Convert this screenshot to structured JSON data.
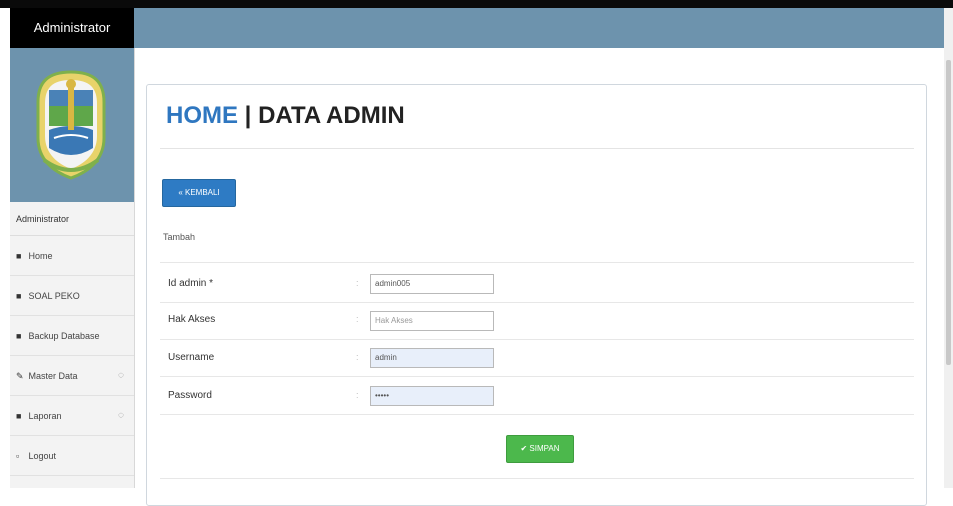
{
  "brand": {
    "title": "Administrator"
  },
  "sidebar": {
    "role": "Administrator",
    "items": [
      {
        "icon": "home-icon",
        "glyph": "■",
        "label": "Home"
      },
      {
        "icon": "home-icon",
        "glyph": "■",
        "label": "SOAL PEKO"
      },
      {
        "icon": "home-icon",
        "glyph": "■",
        "label": "Backup Database"
      },
      {
        "icon": "edit-icon",
        "glyph": "✎",
        "label": "Master Data",
        "caret": "◌"
      },
      {
        "icon": "report-icon",
        "glyph": "■",
        "label": "Laporan",
        "caret": "◌"
      },
      {
        "icon": "logout-icon",
        "glyph": "▫",
        "label": "Logout"
      }
    ]
  },
  "page": {
    "title_home": "HOME",
    "title_sep": " | ",
    "title_main": "DATA ADMIN",
    "back_button": "« KEMBALI",
    "section_label": "Tambah",
    "save_button": "✔ SIMPAN"
  },
  "form": {
    "colon": ":",
    "rows": [
      {
        "label": "Id admin *",
        "value": "admin005",
        "placeholder": ""
      },
      {
        "label": "Hak Akses",
        "value": "",
        "placeholder": "Hak Akses"
      },
      {
        "label": "Username",
        "value": "admin",
        "placeholder": ""
      },
      {
        "label": "Password",
        "value": "•••••",
        "placeholder": ""
      }
    ]
  },
  "colors": {
    "header": "#6d93ad",
    "accent_blue": "#2f77c0",
    "save_green": "#4cb84c"
  }
}
